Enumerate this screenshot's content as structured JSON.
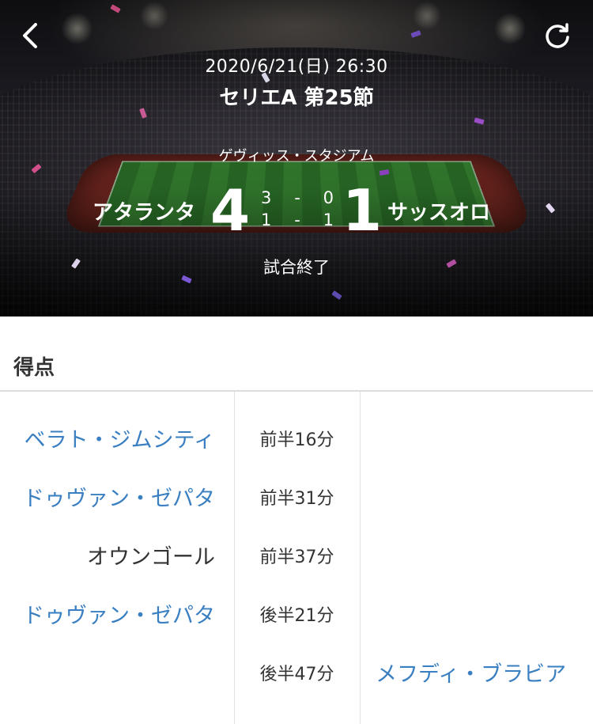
{
  "header": {
    "datetime": "2020/6/21(日) 26:30",
    "competition": "セリエA 第25節",
    "stadium": "ゲヴィッス・スタジアム",
    "status": "試合終了",
    "back_icon": "chevron-left-icon",
    "refresh_icon": "refresh-icon"
  },
  "match": {
    "home_team": "アタランタ",
    "away_team": "サッスオロ",
    "home_score": "4",
    "away_score": "1",
    "first_half": {
      "home": "3",
      "sep": "-",
      "away": "0"
    },
    "second_half": {
      "home": "1",
      "sep": "-",
      "away": "1"
    }
  },
  "goals": {
    "title": "得点",
    "rows": [
      {
        "home": "ベラト・ジムシティ",
        "time": "前半16分",
        "away": ""
      },
      {
        "home": "ドゥヴァン・ゼパタ",
        "time": "前半31分",
        "away": ""
      },
      {
        "home": "オウンゴール",
        "time": "前半37分",
        "away": ""
      },
      {
        "home": "ドゥヴァン・ゼパタ",
        "time": "後半21分",
        "away": ""
      },
      {
        "home": "",
        "time": "後半47分",
        "away": "メフディ・ブラビア"
      }
    ]
  },
  "colors": {
    "link": "#3a7fc1",
    "text": "#333333",
    "divider": "#dcdcdc"
  }
}
